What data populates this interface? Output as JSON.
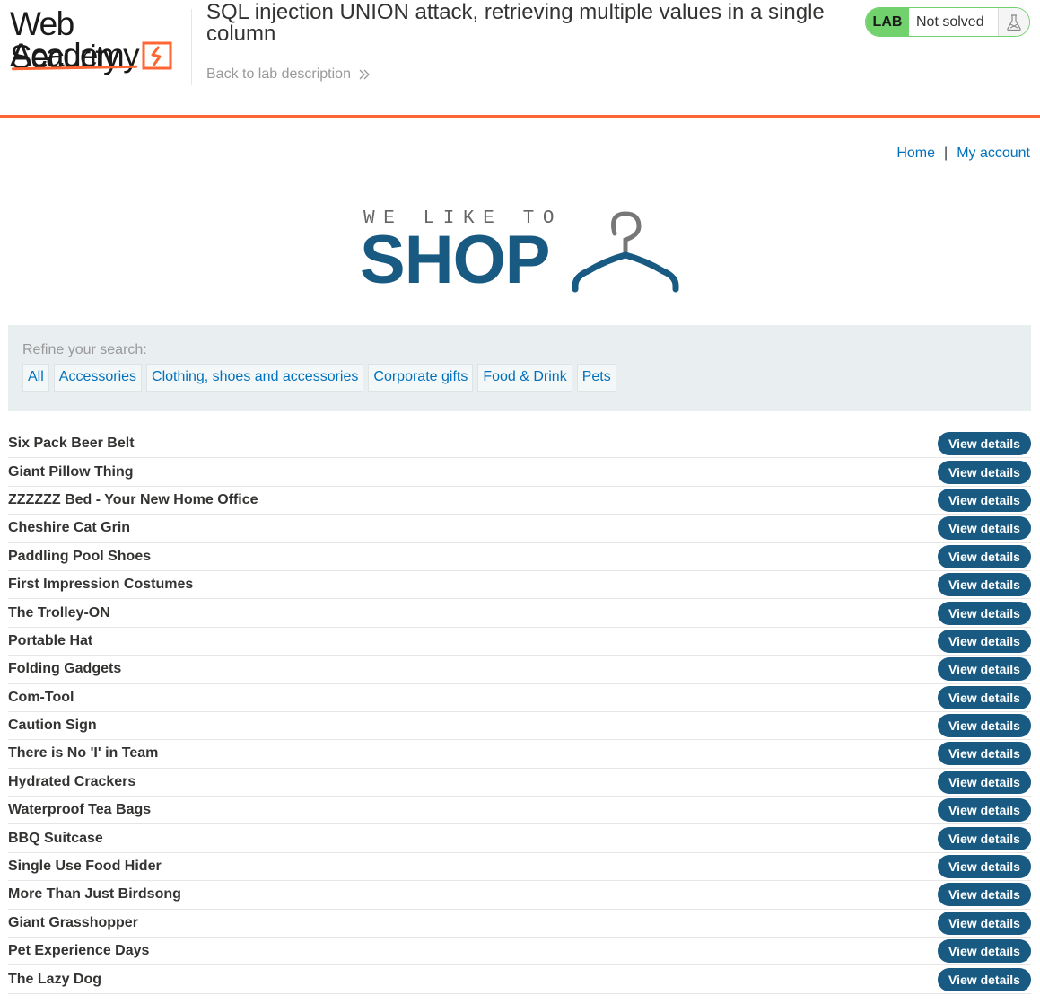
{
  "lab_header": {
    "logo": {
      "line1": "Web Security",
      "line2": "Academy"
    },
    "title": "SQL injection UNION attack, retrieving multiple values in a single column",
    "back_link": "Back to lab description",
    "status": {
      "badge": "LAB",
      "text": "Not solved",
      "badge_color": "#70d16d"
    }
  },
  "nav": {
    "home": "Home",
    "separator": "|",
    "account": "My account"
  },
  "banner": {
    "subtitle": "WE LIKE TO",
    "title": "SHOP"
  },
  "filter": {
    "label": "Refine your search:",
    "categories": [
      "All",
      "Accessories",
      "Clothing, shoes and accessories",
      "Corporate gifts",
      "Food & Drink",
      "Pets"
    ]
  },
  "products": [
    {
      "name": "Six Pack Beer Belt",
      "action": "View details"
    },
    {
      "name": "Giant Pillow Thing",
      "action": "View details"
    },
    {
      "name": "ZZZZZZ Bed - Your New Home Office",
      "action": "View details"
    },
    {
      "name": "Cheshire Cat Grin",
      "action": "View details"
    },
    {
      "name": "Paddling Pool Shoes",
      "action": "View details"
    },
    {
      "name": "First Impression Costumes",
      "action": "View details"
    },
    {
      "name": "The Trolley-ON",
      "action": "View details"
    },
    {
      "name": "Portable Hat",
      "action": "View details"
    },
    {
      "name": "Folding Gadgets",
      "action": "View details"
    },
    {
      "name": "Com-Tool",
      "action": "View details"
    },
    {
      "name": "Caution Sign",
      "action": "View details"
    },
    {
      "name": "There is No 'I' in Team",
      "action": "View details"
    },
    {
      "name": "Hydrated Crackers",
      "action": "View details"
    },
    {
      "name": "Waterproof Tea Bags",
      "action": "View details"
    },
    {
      "name": "BBQ Suitcase",
      "action": "View details"
    },
    {
      "name": "Single Use Food Hider",
      "action": "View details"
    },
    {
      "name": "More Than Just Birdsong",
      "action": "View details"
    },
    {
      "name": "Giant Grasshopper",
      "action": "View details"
    },
    {
      "name": "Pet Experience Days",
      "action": "View details"
    },
    {
      "name": "The Lazy Dog",
      "action": "View details"
    }
  ],
  "colors": {
    "accent": "#ff6633",
    "link": "#0071bc",
    "button": "#185a82",
    "filter_bg": "#e9eef0"
  }
}
